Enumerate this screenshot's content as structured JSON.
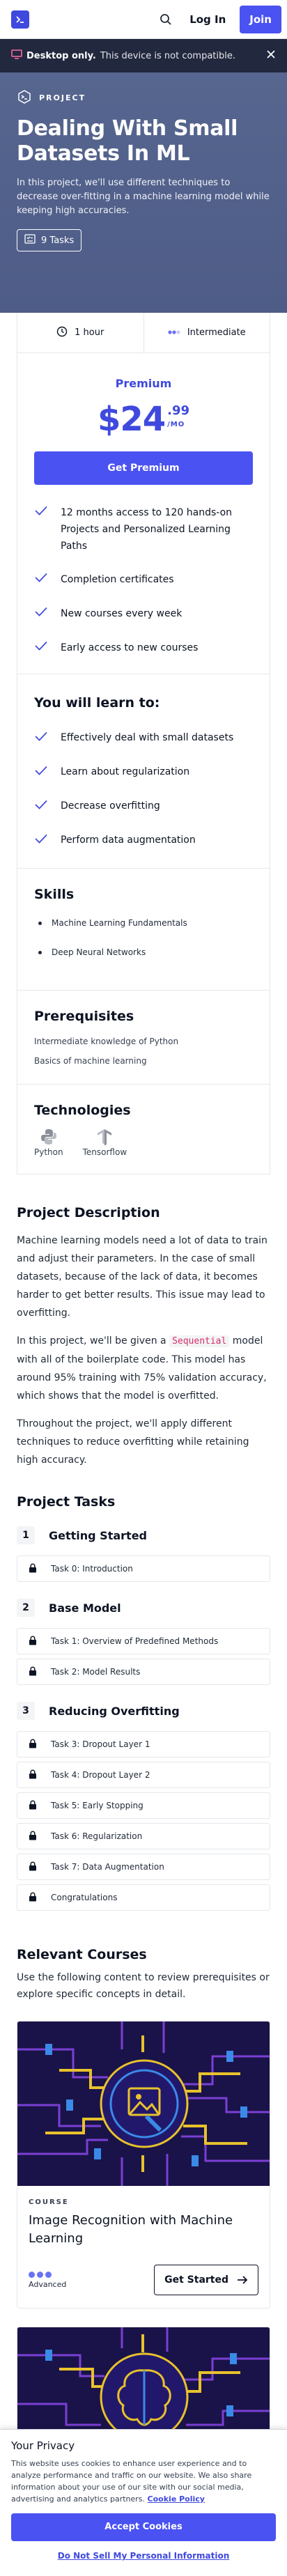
{
  "nav": {
    "login": "Log In",
    "join": "Join"
  },
  "banner": {
    "label": "Desktop only.",
    "message": "This device is not compatible."
  },
  "hero": {
    "tag": "PROJECT",
    "title": "Dealing With Small Datasets In ML",
    "description": "In this project, we'll use different techniques to decrease over-fitting in a machine learning model while keeping high accuracies.",
    "tasks": "9 Tasks"
  },
  "pricing": {
    "duration": "1 hour",
    "level": "Intermediate",
    "plan": "Premium",
    "price_main": "$24",
    "price_cents": ".99",
    "price_period": "/MO",
    "cta": "Get Premium",
    "features": [
      "12 months access to 120 hands-on Projects and Personalized Learning Paths",
      "Completion certificates",
      "New courses every week",
      "Early access to new courses"
    ]
  },
  "learn": {
    "heading": "You will learn to:",
    "items": [
      "Effectively deal with small datasets",
      "Learn about regularization",
      "Decrease overfitting",
      "Perform data augmentation"
    ]
  },
  "skills": {
    "heading": "Skills",
    "items": [
      "Machine Learning Fundamentals",
      "Deep Neural Networks"
    ]
  },
  "prerequisites": {
    "heading": "Prerequisites",
    "items": [
      "Intermediate knowledge of Python",
      "Basics of machine learning"
    ]
  },
  "technologies": {
    "heading": "Technologies",
    "items": [
      "Python",
      "Tensorflow"
    ]
  },
  "description": {
    "heading": "Project Description",
    "p1": "Machine learning models need a lot of data to train and adjust their parameters. In the case of small datasets, because of the lack of data, it becomes harder to get better results. This issue may lead to overfitting.",
    "p2_before": "In this project, we'll be given a ",
    "p2_code": "Sequential",
    "p2_after": " model with all of the boilerplate code. This model has around 95% training with 75% validation accuracy, which shows that the model is overfitted.",
    "p3": "Throughout the project, we'll apply different techniques to reduce overfitting while retaining high accuracy."
  },
  "tasks": {
    "heading": "Project Tasks",
    "groups": [
      {
        "num": "1",
        "title": "Getting Started",
        "items": [
          "Task 0: Introduction"
        ]
      },
      {
        "num": "2",
        "title": "Base Model",
        "items": [
          "Task 1: Overview of Predefined Methods",
          "Task 2: Model Results"
        ]
      },
      {
        "num": "3",
        "title": "Reducing Overfitting",
        "items": [
          "Task 3: Dropout Layer 1",
          "Task 4: Dropout Layer 2",
          "Task 5: Early Stopping",
          "Task 6: Regularization",
          "Task 7: Data Augmentation",
          "Congratulations"
        ]
      }
    ]
  },
  "related": {
    "heading": "Relevant Courses",
    "description": "Use the following content to review prerequisites or explore specific concepts in detail.",
    "course": {
      "kind": "COURSE",
      "title": "Image Recognition with Machine Learning",
      "level": "Advanced",
      "cta": "Get Started"
    }
  },
  "cookie": {
    "title": "Your Privacy",
    "text": "This website uses cookies to enhance user experience and to analyze performance and traffic on our website. We also share information about your use of our site with our social media, advertising and analytics partners.",
    "link": "Cookie Policy",
    "accept": "Accept Cookies",
    "dns": "Do Not Sell My Personal Information"
  },
  "colors": {
    "accent": "#4a52f2",
    "hero": "#56668f",
    "banner": "#22283d",
    "course_bg": "#1a1349",
    "course_line": "#e8c22c"
  },
  "icons": [
    "terminal-logo-icon",
    "search-icon",
    "desktop-icon",
    "close-icon",
    "project-icon",
    "tasks-icon",
    "clock-icon",
    "level-icon",
    "check-icon",
    "python-icon",
    "tensorflow-icon",
    "lock-icon",
    "arrow-right-icon"
  ]
}
